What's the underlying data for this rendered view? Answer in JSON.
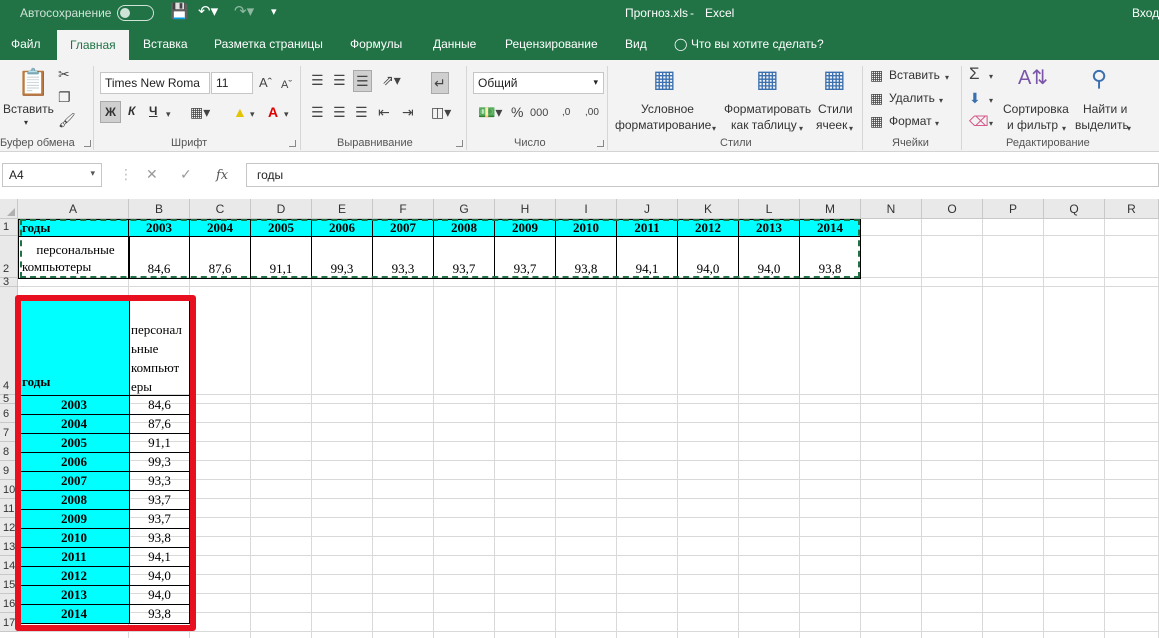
{
  "title": {
    "autosave": "Автосохранение",
    "filename": "Прогноз.xls",
    "app": "Excel",
    "signin": "Вход"
  },
  "tabs": [
    "Файл",
    "Главная",
    "Вставка",
    "Разметка страницы",
    "Формулы",
    "Данные",
    "Рецензирование",
    "Вид",
    "Что вы хотите сделать?"
  ],
  "ribbon": {
    "clipboard": {
      "paste": "Вставить",
      "label": "Буфер обмена"
    },
    "font": {
      "name": "Times New Roma",
      "size": "11",
      "bold": "Ж",
      "italic": "К",
      "underline": "Ч",
      "label": "Шрифт"
    },
    "align": {
      "label": "Выравнивание"
    },
    "number": {
      "format": "Общий",
      "label": "Число"
    },
    "styles": {
      "cond1": "Условное",
      "cond2": "форматирование",
      "table1": "Форматировать",
      "table2": "как таблицу",
      "cell1": "Стили",
      "cell2": "ячеек",
      "label": "Стили"
    },
    "cells": {
      "insert": "Вставить",
      "delete": "Удалить",
      "format": "Формат",
      "label": "Ячейки"
    },
    "edit": {
      "sort1": "Сортировка",
      "sort2": "и фильтр",
      "find1": "Найти и",
      "find2": "выделить",
      "label": "Редактирование"
    }
  },
  "formula_bar": {
    "name_box": "A4",
    "formula": "годы"
  },
  "columns": [
    "A",
    "B",
    "C",
    "D",
    "E",
    "F",
    "G",
    "H",
    "I",
    "J",
    "K",
    "L",
    "M",
    "N",
    "O",
    "P",
    "Q",
    "R"
  ],
  "rows": [
    "1",
    "2",
    "3",
    "4",
    "5",
    "6",
    "7",
    "8",
    "9",
    "10",
    "11",
    "12",
    "13",
    "14",
    "15",
    "16",
    "17"
  ],
  "sheet": {
    "header_label": "годы",
    "row2_label": [
      "персональные",
      "компьютеры"
    ],
    "years": [
      "2003",
      "2004",
      "2005",
      "2006",
      "2007",
      "2008",
      "2009",
      "2010",
      "2011",
      "2012",
      "2013",
      "2014"
    ],
    "values": [
      "84,6",
      "87,6",
      "91,1",
      "99,3",
      "93,3",
      "93,7",
      "93,7",
      "93,8",
      "94,1",
      "94,0",
      "94,0",
      "93,8"
    ],
    "vertical_header": [
      "персонал",
      "ьные",
      "компьют",
      "еры"
    ]
  },
  "colors": {
    "excel_green": "#217346",
    "cyan": "#00ffff",
    "highlight_red": "#e8101e"
  }
}
